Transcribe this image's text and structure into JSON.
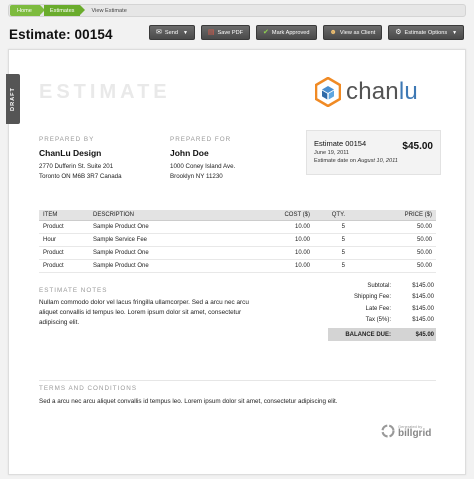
{
  "breadcrumb": {
    "home": "Home",
    "estimates": "Estimates",
    "current": "View Estimate"
  },
  "page": {
    "title": "Estimate: 00154"
  },
  "toolbar": {
    "send": "Send",
    "save_pdf": "Save PDF",
    "mark_approved": "Mark Approved",
    "view_as_client": "View as Client",
    "estimate_options": "Estimate Options"
  },
  "document": {
    "draft_tab": "DRAFT",
    "heading": "ESTIMATE",
    "logo": {
      "part1": "chan",
      "part2": "lu"
    },
    "prepared_by": {
      "label": "PREPARED BY",
      "name": "ChanLu Design",
      "line1": "2770 Dufferin St. Suite 201",
      "line2": "Toronto ON M6B 3R7 Canada"
    },
    "prepared_for": {
      "label": "PREPARED FOR",
      "name": "John Doe",
      "line1": "1000 Coney Island Ave.",
      "line2": "Brooklyn NY 11230"
    },
    "summary": {
      "number": "Estimate 00154",
      "amount": "$45.00",
      "date": "June 19, 2011",
      "due_prefix": "Estimate date on ",
      "due_date": "August 10, 2011"
    },
    "table": {
      "headers": {
        "item": "ITEM",
        "description": "DESCRIPTION",
        "cost": "COST ($)",
        "qty": "QTY.",
        "price": "PRICE ($)"
      },
      "rows": [
        {
          "item": "Product",
          "description": "Sample Product One",
          "cost": "10.00",
          "qty": "5",
          "price": "50.00"
        },
        {
          "item": "Hour",
          "description": "Sample Service Fee",
          "cost": "10.00",
          "qty": "5",
          "price": "50.00"
        },
        {
          "item": "Product",
          "description": "Sample Product One",
          "cost": "10.00",
          "qty": "5",
          "price": "50.00"
        },
        {
          "item": "Product",
          "description": "Sample Product One",
          "cost": "10.00",
          "qty": "5",
          "price": "50.00"
        }
      ]
    },
    "notes": {
      "label": "ESTIMATE NOTES",
      "text": "Nullam commodo dolor vel lacus fringilla ullamcorper. Sed a arcu nec arcu aliquet convallis id tempus leo. Lorem ipsum dolor sit amet, consectetur adipiscing elit."
    },
    "totals": {
      "subtotal_label": "Subtotal:",
      "subtotal": "$145.00",
      "shipping_label": "Shipping Fee:",
      "shipping": "$145.00",
      "late_label": "Late Fee:",
      "late": "$145.00",
      "tax_label": "Tax (5%):",
      "tax": "$145.00",
      "balance_label": "BALANCE DUE:",
      "balance": "$45.00"
    },
    "terms": {
      "label": "TERMS AND CONDITIONS",
      "text": "Sed a arcu nec arcu aliquet convallis id tempus leo. Lorem ipsum dolor sit amet, consectetur adipiscing elit."
    },
    "footer": {
      "generated_by": "Generated by",
      "brand": "billgrid"
    }
  }
}
